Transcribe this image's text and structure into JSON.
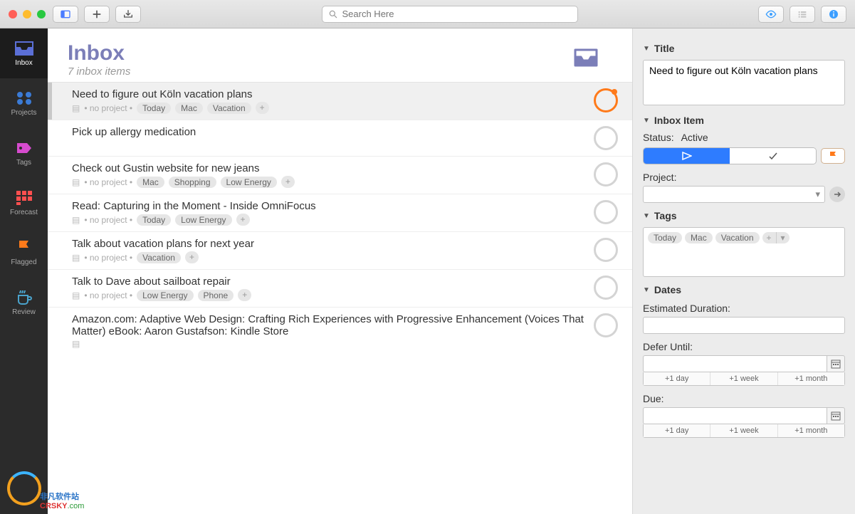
{
  "toolbar": {
    "search_placeholder": "Search Here"
  },
  "sidebar": {
    "items": [
      {
        "label": "Inbox",
        "icon": "inbox-tray-icon",
        "color": "#5b6fd6",
        "selected": true
      },
      {
        "label": "Projects",
        "icon": "projects-icon",
        "color": "#3b7bd6",
        "selected": false
      },
      {
        "label": "Tags",
        "icon": "tag-icon",
        "color": "#d64bce",
        "selected": false
      },
      {
        "label": "Forecast",
        "icon": "forecast-icon",
        "color": "#ff4f4f",
        "selected": false
      },
      {
        "label": "Flagged",
        "icon": "flag-icon",
        "color": "#ff7a1a",
        "selected": false
      },
      {
        "label": "Review",
        "icon": "coffee-icon",
        "color": "#4aa3cc",
        "selected": false
      }
    ]
  },
  "content": {
    "title": "Inbox",
    "subtitle": "7 inbox items",
    "tasks": [
      {
        "title": "Need to figure out Köln vacation plans",
        "no_project": true,
        "tags": [
          "Today",
          "Mac",
          "Vacation"
        ],
        "add_tag": true,
        "circle": "today",
        "selected": true,
        "has_note": true
      },
      {
        "title": "Pick up allergy medication",
        "no_project": false,
        "tags": [],
        "add_tag": false,
        "circle": "normal",
        "selected": false,
        "has_note": false
      },
      {
        "title": "Check out Gustin website for new jeans",
        "no_project": true,
        "tags": [
          "Mac",
          "Shopping",
          "Low Energy"
        ],
        "add_tag": true,
        "circle": "normal",
        "selected": false,
        "has_note": true
      },
      {
        "title": "Read: Capturing in the Moment - Inside OmniFocus",
        "no_project": true,
        "tags": [
          "Today",
          "Low Energy"
        ],
        "add_tag": true,
        "circle": "normal",
        "selected": false,
        "has_note": true
      },
      {
        "title": "Talk about vacation plans for next year",
        "no_project": true,
        "tags": [
          "Vacation"
        ],
        "add_tag": true,
        "circle": "normal",
        "selected": false,
        "has_note": true
      },
      {
        "title": "Talk to Dave about sailboat repair",
        "no_project": true,
        "tags": [
          "Low Energy",
          "Phone"
        ],
        "add_tag": true,
        "circle": "normal",
        "selected": false,
        "has_note": true
      },
      {
        "title": "Amazon.com: Adaptive Web Design: Crafting Rich Experiences with Progressive Enhancement (Voices That Matter) eBook: Aaron Gustafson: Kindle Store",
        "no_project": false,
        "tags": [],
        "add_tag": false,
        "circle": "normal",
        "selected": false,
        "has_note": true
      }
    ],
    "no_project_label": "no project"
  },
  "inspector": {
    "title_section": "Title",
    "title_value": "Need to figure out Köln vacation plans",
    "inbox_item_section": "Inbox Item",
    "status_label": "Status:",
    "status_value": "Active",
    "project_label": "Project:",
    "tags_section": "Tags",
    "tags": [
      "Today",
      "Mac",
      "Vacation"
    ],
    "dates_section": "Dates",
    "estimated_label": "Estimated Duration:",
    "defer_label": "Defer Until:",
    "due_label": "Due:",
    "quick_dates": [
      "+1 day",
      "+1 week",
      "+1 month"
    ]
  },
  "watermark": {
    "line1": "非凡软件站",
    "line2a": "CRSKY",
    "line2b": ".com"
  }
}
